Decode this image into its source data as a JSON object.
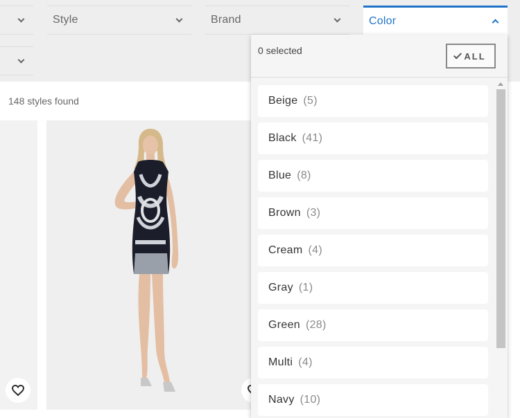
{
  "filters": {
    "style_label": "Style",
    "brand_label": "Brand",
    "color_label": "Color"
  },
  "results": {
    "count_text": "148 styles found"
  },
  "color_dropdown": {
    "selected_text": "0 selected",
    "all_button_label": "ALL",
    "options": [
      {
        "label": "Beige",
        "count": "(5)"
      },
      {
        "label": "Black",
        "count": "(41)"
      },
      {
        "label": "Blue",
        "count": "(8)"
      },
      {
        "label": "Brown",
        "count": "(3)"
      },
      {
        "label": "Cream",
        "count": "(4)"
      },
      {
        "label": "Gray",
        "count": "(1)"
      },
      {
        "label": "Green",
        "count": "(28)"
      },
      {
        "label": "Multi",
        "count": "(4)"
      },
      {
        "label": "Navy",
        "count": "(10)"
      }
    ]
  },
  "colors": {
    "accent": "#1e73c8",
    "page_bg": "#eeeeee"
  },
  "icons": {
    "chevron": "chevron-down-icon",
    "check": "check-icon",
    "wishlist": "heart-icon"
  }
}
